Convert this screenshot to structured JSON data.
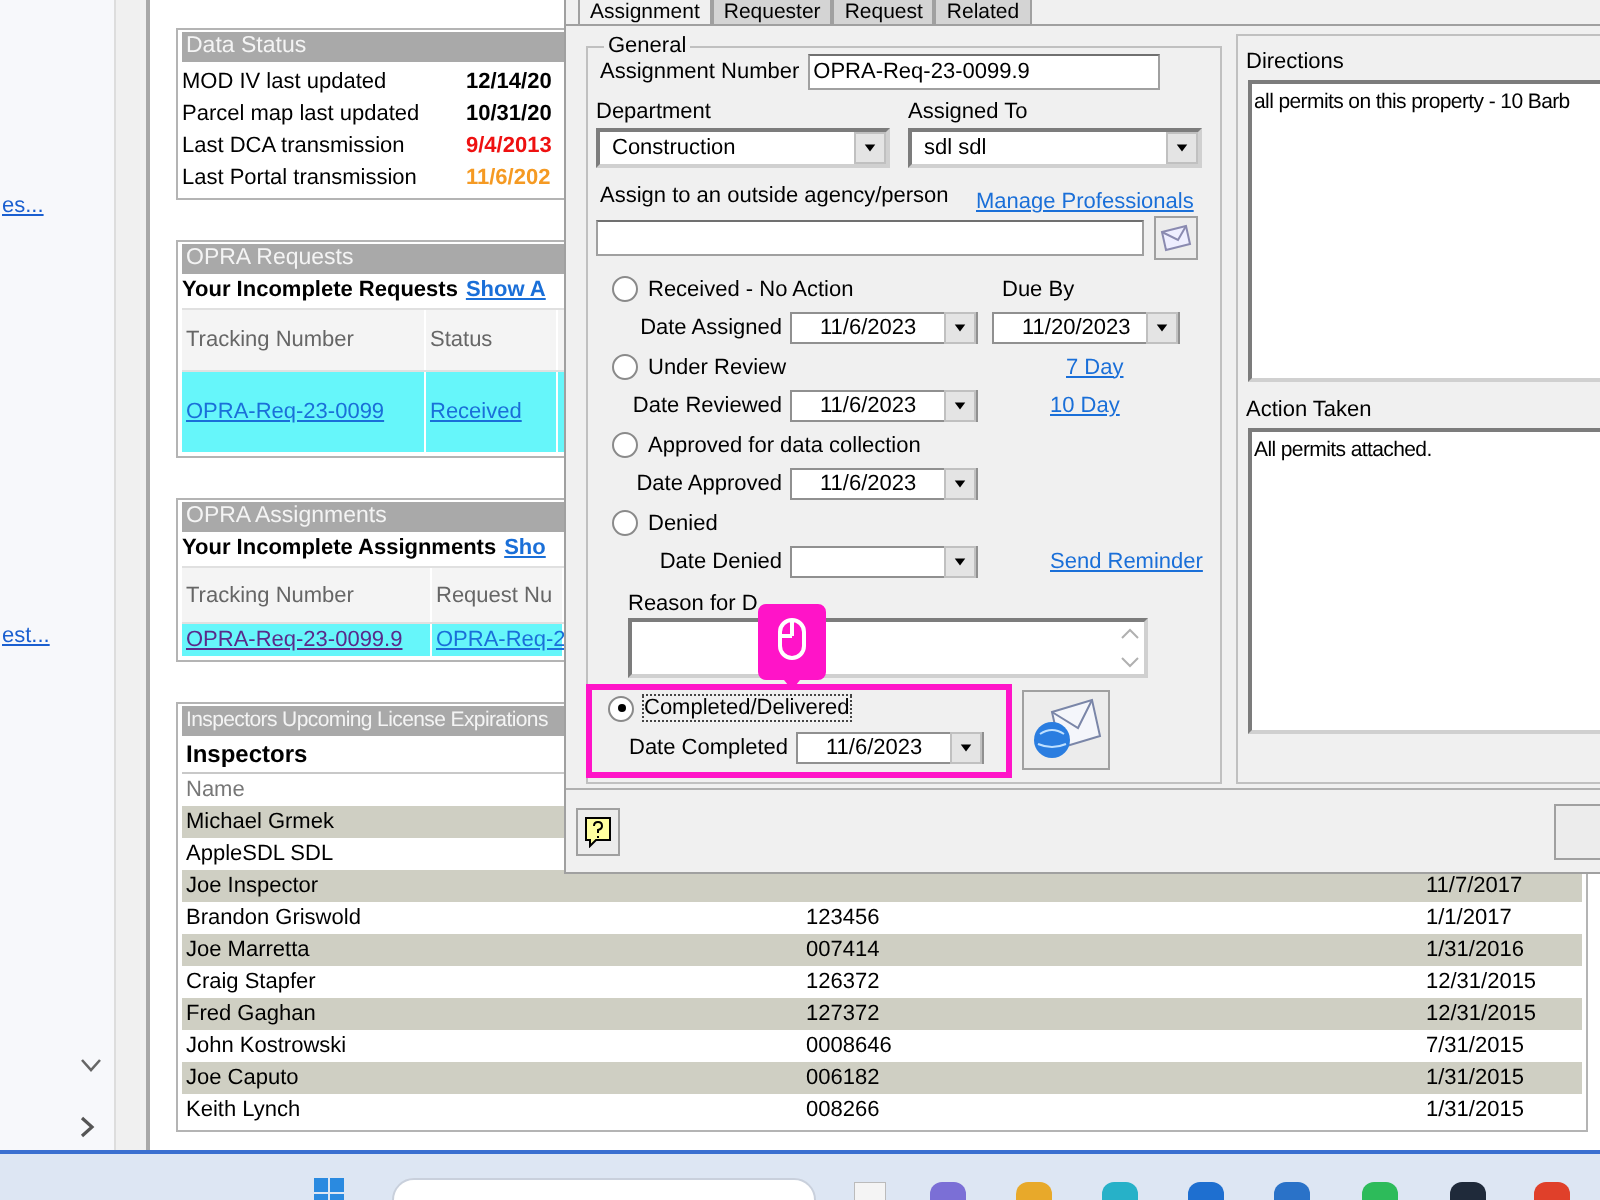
{
  "sidebar": {
    "links": [
      "es...",
      "est..."
    ]
  },
  "data_status": {
    "title": "Data Status",
    "rows": [
      {
        "label": "MOD IV last updated",
        "value": "12/14/20",
        "color": "#000000"
      },
      {
        "label": "Parcel map last updated",
        "value": "10/31/20",
        "color": "#000000"
      },
      {
        "label": "Last DCA transmission",
        "value": "9/4/2013",
        "color": "#ee1111"
      },
      {
        "label": "Last Portal transmission",
        "value": "11/6/202",
        "color": "#f59a23"
      }
    ]
  },
  "opra_requests": {
    "title": "OPRA Requests",
    "heading": "Your Incomplete Requests",
    "heading_link": "Show A",
    "columns": [
      "Tracking Number",
      "Status"
    ],
    "rows": [
      {
        "tracking": "OPRA-Req-23-0099",
        "status": "Received",
        "visited": false
      }
    ]
  },
  "opra_assignments": {
    "title": "OPRA Assignments",
    "heading": "Your Incomplete Assignments",
    "heading_link": "Sho",
    "columns": [
      "Tracking Number",
      "Request Nu"
    ],
    "rows": [
      {
        "tracking": "OPRA-Req-23-0099.9",
        "request": "OPRA-Req-2",
        "visited": true
      }
    ]
  },
  "inspectors": {
    "title": "Inspectors Upcoming License Expirations",
    "heading": "Inspectors",
    "columns": [
      "Name"
    ],
    "rows": [
      {
        "name": "Michael Grmek"
      },
      {
        "name": "AppleSDL SDL"
      },
      {
        "name": "Joe Inspector",
        "column_3": "11/7/2017"
      },
      {
        "name": "Brandon Griswold",
        "column_2": "123456",
        "column_3": "1/1/2017"
      },
      {
        "name": "Joe Marretta",
        "column_2": "007414",
        "column_3": "1/31/2016"
      },
      {
        "name": "Craig Stapfer",
        "column_2": "126372",
        "column_3": "12/31/2015"
      },
      {
        "name": "Fred Gaghan",
        "column_2": "127372",
        "column_3": "12/31/2015"
      },
      {
        "name": "John Kostrowski",
        "column_2": "0008646",
        "column_3": "7/31/2015"
      },
      {
        "name": "Joe Caputo",
        "column_2": "006182",
        "column_3": "1/31/2015"
      },
      {
        "name": "Keith Lynch",
        "column_2": "008266",
        "column_3": "1/31/2015"
      }
    ]
  },
  "dialog": {
    "tabs": [
      {
        "label": "Assignment",
        "selected": true
      },
      {
        "label": "Requester",
        "selected": false
      },
      {
        "label": "Request",
        "selected": false
      },
      {
        "label": "Related",
        "selected": false
      }
    ],
    "group_title": "General",
    "assignment_number": {
      "label": "Assignment Number",
      "value": "OPRA-Req-23-0099.9"
    },
    "department": {
      "label": "Department",
      "value": "Construction"
    },
    "assigned_to": {
      "label": "Assigned To",
      "value": "sdl sdl"
    },
    "outside": {
      "label": "Assign to an outside agency/person",
      "link": "Manage Professionals"
    },
    "statuses": [
      {
        "label": "Received - No Action",
        "selected": false,
        "date_label": "Date Assigned",
        "date": "11/6/2023",
        "aside_top": {
          "kind": "label",
          "text": "Due By"
        },
        "aside_bottom": {
          "kind": "date",
          "text": "11/20/2023"
        }
      },
      {
        "label": "Under Review",
        "selected": false,
        "date_label": "Date Reviewed",
        "date": "11/6/2023",
        "aside_top": {
          "kind": "link",
          "text": "7 Day"
        },
        "aside_bottom": {
          "kind": "link",
          "text": "10 Day"
        }
      },
      {
        "label": "Approved for data collection",
        "selected": false,
        "date_label": "Date Approved",
        "date": "11/6/2023"
      },
      {
        "label": "Denied",
        "selected": false,
        "date_label": "Date Denied",
        "aside_bottom": {
          "kind": "link",
          "text": "Send Reminder"
        },
        "reason_label": "Reason for D"
      },
      {
        "label": "Completed/Delivered",
        "selected": true,
        "date_label": "Date Completed",
        "date": "11/6/2023",
        "highlighted": true,
        "click_marker": true
      }
    ],
    "directions": {
      "label": "Directions",
      "value": "all permits on this property - 10 Barb"
    },
    "action_taken": {
      "label": "Action Taken",
      "value": "All permits attached."
    }
  }
}
